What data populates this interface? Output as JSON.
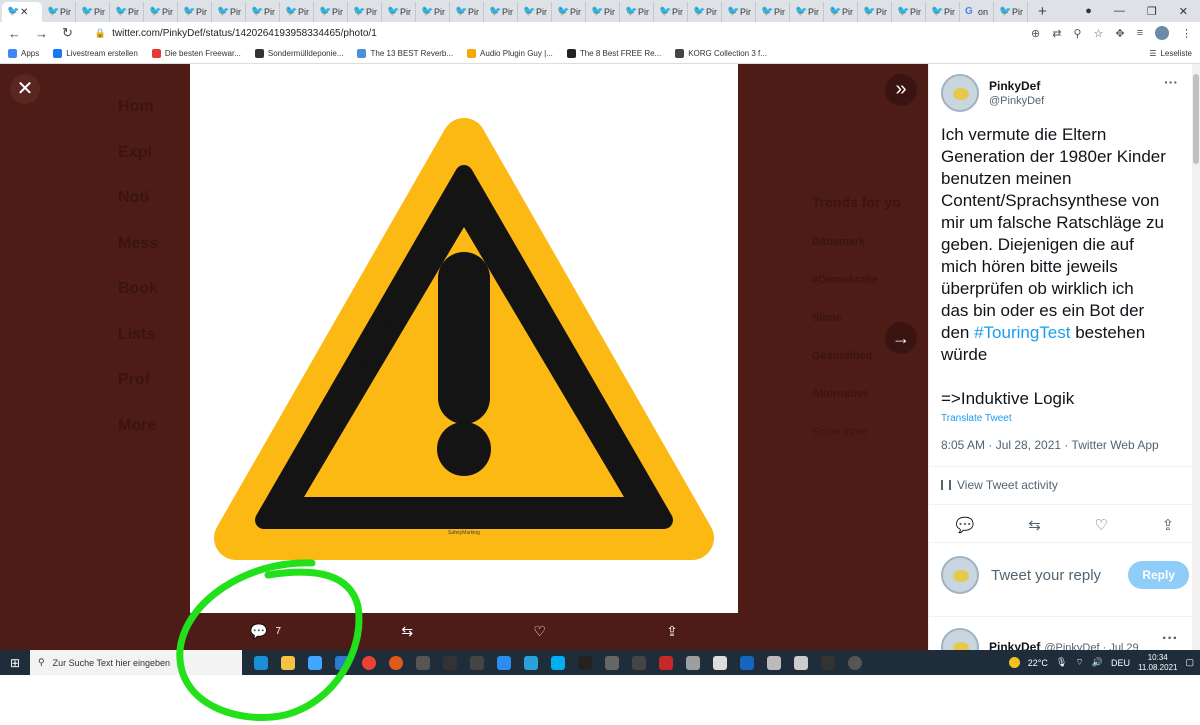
{
  "browser": {
    "tabs": [
      {
        "label": ""
      },
      {
        "label": "Pir"
      },
      {
        "label": "Pir"
      },
      {
        "label": "Pir"
      },
      {
        "label": "Pir"
      },
      {
        "label": "Pir"
      },
      {
        "label": "Pir"
      },
      {
        "label": "Pir"
      },
      {
        "label": "Pir"
      },
      {
        "label": "Pir"
      },
      {
        "label": "Pir"
      },
      {
        "label": "Pir"
      },
      {
        "label": "Pir"
      },
      {
        "label": "Pir"
      },
      {
        "label": "Pir"
      },
      {
        "label": "Pir"
      },
      {
        "label": "Pir"
      },
      {
        "label": "Pir"
      },
      {
        "label": "Pir"
      },
      {
        "label": "Pir"
      },
      {
        "label": "Pir"
      },
      {
        "label": "Pir"
      },
      {
        "label": "Pir"
      },
      {
        "label": "Pir"
      },
      {
        "label": "Pir"
      },
      {
        "label": "Pir"
      },
      {
        "label": "Pir"
      },
      {
        "label": "Pir"
      },
      {
        "label": "on"
      },
      {
        "label": "Pir"
      }
    ],
    "url": "twitter.com/PinkyDef/status/1420264193958334465/photo/1",
    "bookmarks": [
      {
        "label": "Apps",
        "color": "#4285f4"
      },
      {
        "label": "Livestream erstellen",
        "color": "#1877f2"
      },
      {
        "label": "Die besten Freewar...",
        "color": "#e53935"
      },
      {
        "label": "Sondermülldeponie...",
        "color": "#333333"
      },
      {
        "label": "The 13 BEST Reverb...",
        "color": "#4a90d9"
      },
      {
        "label": "Audio Plugin Guy |...",
        "color": "#f2a900"
      },
      {
        "label": "The 8 Best FREE Re...",
        "color": "#222222"
      },
      {
        "label": "KORG Collection 3 f...",
        "color": "#444444"
      }
    ],
    "reading_list": "Leseliste"
  },
  "background": {
    "nav": [
      "Hom",
      "Expl",
      "Noti",
      "Mess",
      "Book",
      "Lists",
      "Prof",
      "More"
    ],
    "trends_header": "Trends for yo",
    "trends": [
      "Dänemark",
      "#Demokratie",
      "Sinne",
      "Gesundheit",
      "Alternative"
    ],
    "show_more": "Show more"
  },
  "photo_actions": {
    "reply_count": "7"
  },
  "tweet": {
    "name": "PinkyDef",
    "handle": "@PinkyDef",
    "text_lines": [
      "Ich vermute die Eltern",
      "Generation der 1980er Kinder",
      "benutzen meinen",
      "Content/Sprachsynthese von",
      "mir um falsche Ratschläge zu",
      "geben. Diejenigen die auf",
      "mich hören bitte jeweils",
      "überprüfen ob wirklich ich",
      "das bin oder es ein Bot der"
    ],
    "last_line_pre": "den ",
    "hashtag": "#TouringTest",
    "last_line_post": " bestehen",
    "line_wuerde": "würde",
    "logic": "=>Induktive Logik",
    "translate": "Translate Tweet",
    "meta": "8:05 AM · Jul 28, 2021 · Twitter Web App",
    "activity": "View Tweet activity",
    "reply_placeholder": "Tweet your reply",
    "reply_button": "Reply",
    "next_name": "PinkyDef",
    "next_handle": "@PinkyDef · Jul 29"
  },
  "taskbar": {
    "search_placeholder": "Zur Suche Text hier eingeben",
    "temperature": "22°C",
    "language": "DEU",
    "time": "10:34",
    "date": "11.08.2021"
  },
  "sign": {
    "brand": "SafetyMarking"
  },
  "colors": {
    "overlay": "#4e1c17",
    "warning_yellow": "#fcb813",
    "highlight_circle": "#22e01a",
    "twitter_blue": "#1d9bf0"
  }
}
